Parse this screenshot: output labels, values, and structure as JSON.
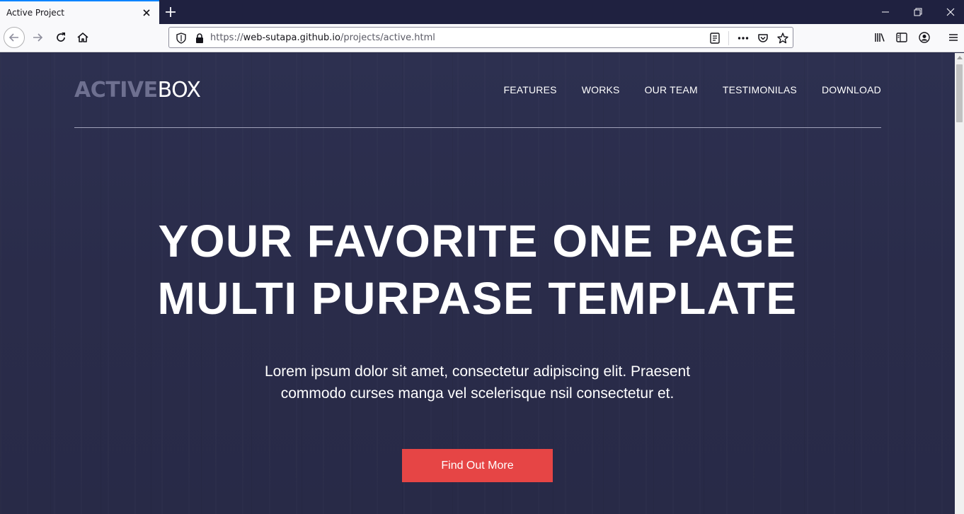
{
  "browser": {
    "tab": {
      "title": "Active Project"
    },
    "url": {
      "prefix": "https://",
      "host": "web-sutapa.github.io",
      "path": "/projects/active.html"
    }
  },
  "site": {
    "logo": {
      "part1": "ACTIVE",
      "part2": "BOX"
    },
    "nav": [
      "FEATURES",
      "WORKS",
      "OUR TEAM",
      "TESTIMONILAS",
      "DOWNLOAD"
    ],
    "hero": {
      "title_line1": "YOUR FAVORITE ONE PAGE",
      "title_line2": "MULTI PURPASE TEMPLATE",
      "subtitle_line1": "Lorem ipsum dolor sit amet, consectetur adipiscing elit. Praesent",
      "subtitle_line2": "commodo curses manga vel scelerisque nsil consectetur et.",
      "cta": "Find Out More"
    }
  },
  "colors": {
    "accent": "#e64545",
    "background": "#2a2d4a",
    "tab_highlight": "#0a84ff"
  }
}
